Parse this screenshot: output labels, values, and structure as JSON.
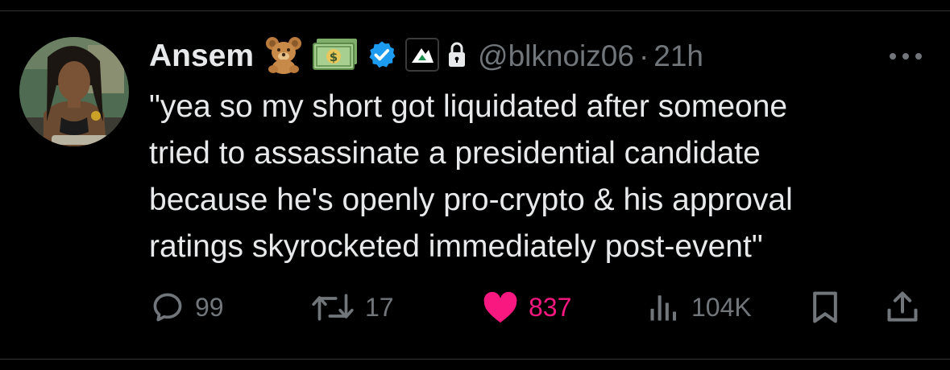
{
  "tweet": {
    "author": {
      "display_name": "Ansem",
      "badges": [
        "teddy-bear-emoji",
        "dollar-banknote-emoji",
        "verified-badge",
        "affiliate-badge",
        "protected-lock"
      ],
      "handle": "@blknoiz06",
      "separator": "·",
      "time": "21h"
    },
    "text_lines": [
      "\"yea so my short got liquidated after someone",
      "tried to assassinate a presidential candidate",
      "because he's openly pro-crypto & his approval",
      "ratings skyrocketed immediately post-event\""
    ],
    "actions": {
      "replies": "99",
      "reposts": "17",
      "likes": "837",
      "views": "104K"
    }
  },
  "colors": {
    "background": "#000000",
    "text": "#e7e9ea",
    "muted": "#71767b",
    "like": "#f91880",
    "verified": "#1d9bf0",
    "divider": "#2f3336"
  }
}
